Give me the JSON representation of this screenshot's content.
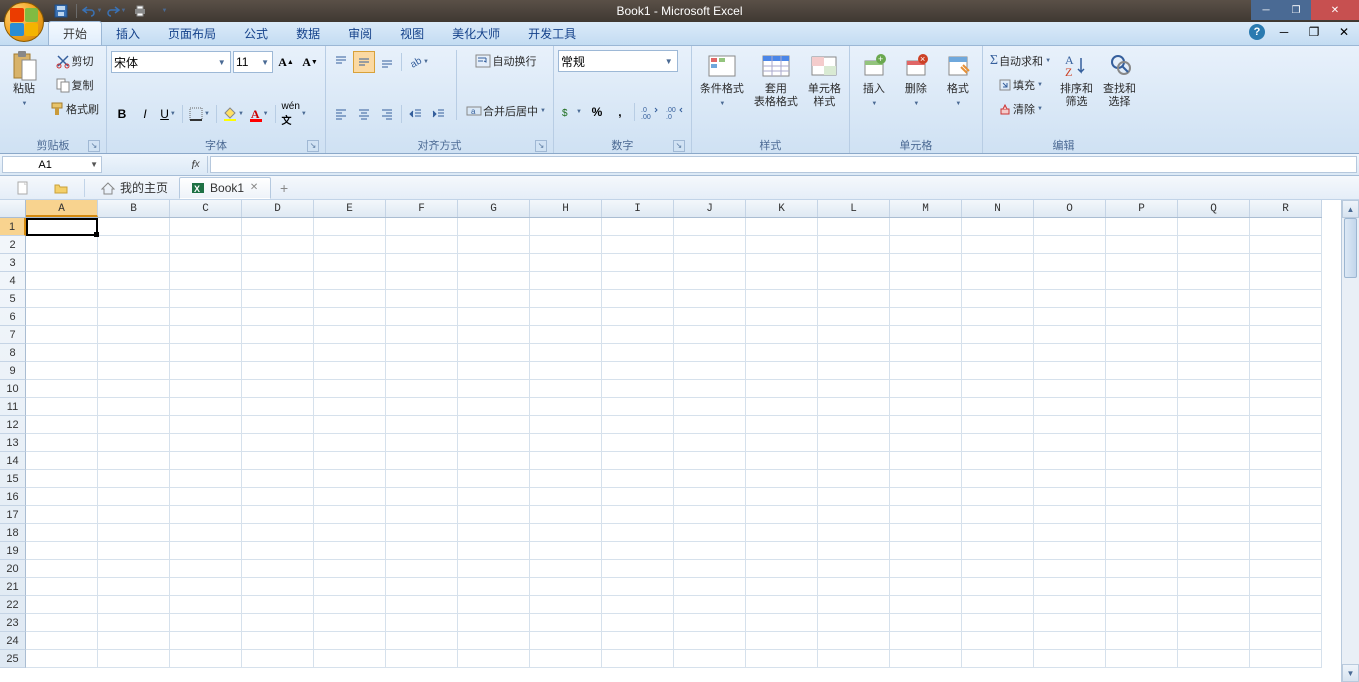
{
  "title": "Book1 - Microsoft Excel",
  "qat": {
    "save": "save-icon",
    "undo": "undo-icon",
    "redo": "redo-icon",
    "print": "print-icon"
  },
  "tabs": {
    "items": [
      "开始",
      "插入",
      "页面布局",
      "公式",
      "数据",
      "审阅",
      "视图",
      "美化大师",
      "开发工具"
    ],
    "active": 0
  },
  "ribbon": {
    "clipboard": {
      "label": "剪贴板",
      "paste": "粘贴",
      "cut": "剪切",
      "copy": "复制",
      "formatPainter": "格式刷"
    },
    "font": {
      "label": "字体",
      "name": "宋体",
      "size": "11",
      "bold": "B",
      "italic": "I",
      "underline": "U"
    },
    "alignment": {
      "label": "对齐方式",
      "wrap": "自动换行",
      "merge": "合并后居中"
    },
    "number": {
      "label": "数字",
      "format": "常规",
      "percent": "%",
      "comma": ",",
      "inc": ".00→.0",
      "dec": ".0→.00"
    },
    "styles": {
      "label": "样式",
      "condfmt": "条件格式",
      "tableStyle": "套用\n表格格式",
      "cellStyle": "单元格\n样式"
    },
    "cells": {
      "label": "单元格",
      "insert": "插入",
      "delete": "删除",
      "format": "格式"
    },
    "editing": {
      "label": "编辑",
      "autosum": "自动求和",
      "fill": "填充",
      "clear": "清除",
      "sortFilter": "排序和\n筛选",
      "findSelect": "查找和\n选择"
    }
  },
  "namebox": "A1",
  "docTabs": {
    "home": "我的主页",
    "book": "Book1"
  },
  "columns": [
    "A",
    "B",
    "C",
    "D",
    "E",
    "F",
    "G",
    "H",
    "I",
    "J",
    "K",
    "L",
    "M",
    "N",
    "O",
    "P",
    "Q",
    "R"
  ],
  "rowCount": 25,
  "activeCell": {
    "col": 0,
    "row": 0
  }
}
